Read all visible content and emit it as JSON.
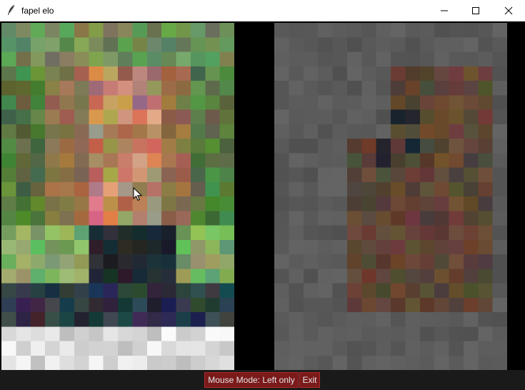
{
  "window": {
    "title": "fapel elo",
    "icons": {
      "app": "feather-icon",
      "minimize": "minimize-icon",
      "maximize": "maximize-icon",
      "close": "close-icon"
    }
  },
  "panes": {
    "left": {
      "description": "pixelated photo (left)"
    },
    "right": {
      "description": "pixelated dimmed photo (right)"
    }
  },
  "controls": {
    "mouse_mode": "Mouse Mode: Left only",
    "exit": "Exit"
  },
  "colors": {
    "button_bg": "#7a1a1a",
    "button_border": "#b22a2a",
    "statusbar_bg": "#1a1a1a",
    "right_bg": "#5a5a5a"
  }
}
